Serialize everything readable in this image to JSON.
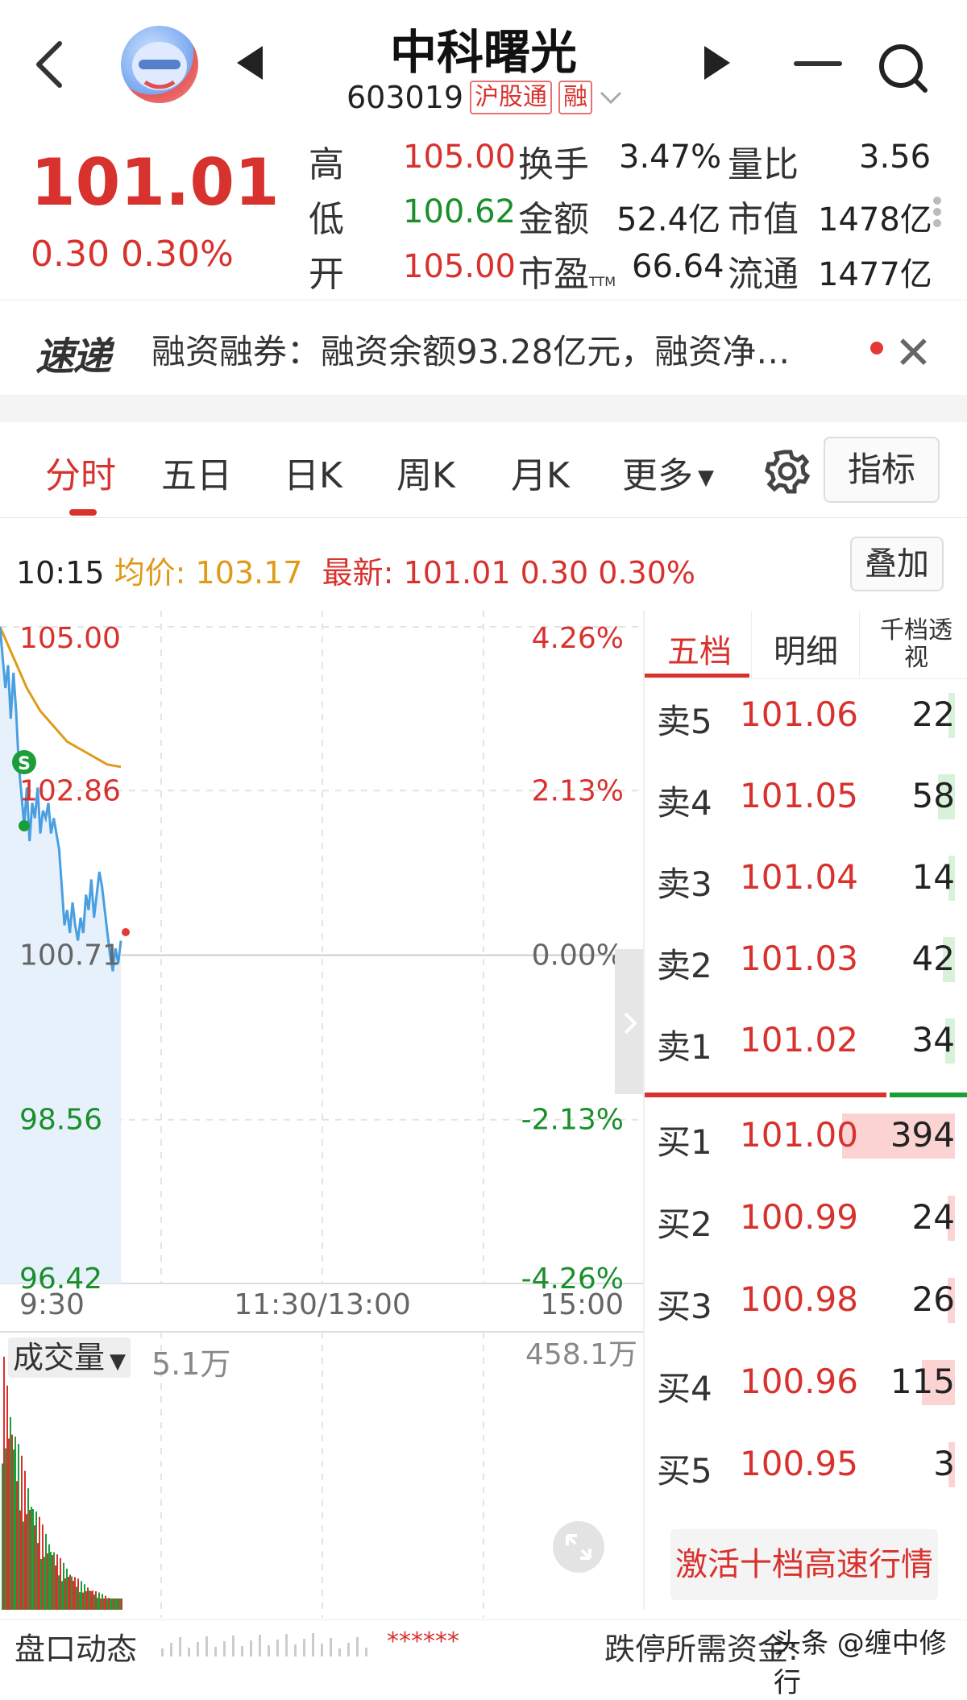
{
  "header": {
    "title": "中科曙光",
    "code": "603019",
    "tags": [
      "沪股通",
      "融"
    ]
  },
  "quote": {
    "price": "101.01",
    "change": "0.30",
    "change_pct": "0.30%",
    "stats": [
      {
        "label": "高",
        "value": "105.00",
        "color": "red"
      },
      {
        "label": "低",
        "value": "100.62",
        "color": "green"
      },
      {
        "label": "开",
        "value": "105.00",
        "color": "red"
      },
      {
        "label": "换手",
        "value": "3.47%"
      },
      {
        "label": "金额",
        "value": "52.4亿"
      },
      {
        "label": "市盈",
        "sub": "TTM",
        "value": "66.64"
      },
      {
        "label": "量比",
        "value": "3.56"
      },
      {
        "label": "市值",
        "value": "1478亿"
      },
      {
        "label": "流通",
        "value": "1477亿"
      }
    ]
  },
  "news": {
    "logo": "速递",
    "text": "融资融券：融资余额93.28亿元，融资净…"
  },
  "tabs": [
    "分时",
    "五日",
    "日K",
    "周K",
    "月K",
    "更多"
  ],
  "buttons": {
    "indicator": "指标",
    "overlay": "叠加",
    "activate": "激活十档高速行情"
  },
  "info_bar": {
    "time": "10:15",
    "avg_label": "均价:",
    "avg_value": "103.17",
    "latest_label": "最新:",
    "latest_value": "101.01 0.30 0.30%"
  },
  "chart_data": {
    "type": "line",
    "title": "",
    "y_left_ticks": [
      "105.00",
      "102.86",
      "100.71",
      "98.56",
      "96.42"
    ],
    "y_right_ticks": [
      "4.26%",
      "2.13%",
      "0.00%",
      "-2.13%",
      "-4.26%"
    ],
    "x_ticks": [
      "9:30",
      "11:30/13:00",
      "15:00"
    ],
    "ylim": [
      96.42,
      105.0
    ],
    "prev_close": 100.71,
    "session_minutes": 240,
    "series": [
      {
        "color": "#4a9fe0",
        "x": [
          0,
          1,
          2,
          3,
          4,
          5,
          6,
          7,
          8,
          9,
          10,
          11,
          12,
          13,
          14,
          15,
          16,
          17,
          18,
          19,
          20,
          21,
          22,
          23,
          24,
          25,
          26,
          27,
          28,
          29,
          30,
          31,
          32,
          33,
          34,
          35,
          36,
          37,
          38,
          39,
          40,
          41,
          42,
          43,
          44,
          45
        ],
        "values": [
          105.0,
          104.6,
          104.2,
          104.5,
          103.8,
          104.4,
          103.9,
          103.2,
          102.8,
          102.4,
          102.9,
          102.2,
          102.7,
          102.5,
          102.9,
          102.3,
          102.6,
          102.5,
          102.7,
          102.3,
          102.5,
          102.3,
          102.1,
          101.6,
          101.1,
          101.3,
          101.0,
          101.4,
          101.1,
          100.9,
          101.2,
          101.0,
          101.5,
          101.3,
          101.7,
          101.2,
          101.5,
          101.8,
          101.6,
          101.3,
          101.0,
          100.7,
          100.5,
          100.8,
          100.6,
          100.9
        ]
      },
      {
        "color": "#e09a1a",
        "x": [
          0,
          5,
          10,
          15,
          20,
          25,
          30,
          35,
          40,
          45
        ],
        "values": [
          105.0,
          104.6,
          104.2,
          103.9,
          103.7,
          103.5,
          103.4,
          103.3,
          103.2,
          103.17
        ]
      }
    ],
    "volume_max": "458.1万",
    "volume_latest": "5.1万"
  },
  "order_book": {
    "tabs": [
      "五档",
      "明细",
      "千档透视"
    ],
    "asks": [
      {
        "label": "卖5",
        "price": "101.06",
        "vol": "22"
      },
      {
        "label": "卖4",
        "price": "101.05",
        "vol": "58"
      },
      {
        "label": "卖3",
        "price": "101.04",
        "vol": "14"
      },
      {
        "label": "卖2",
        "price": "101.03",
        "vol": "42"
      },
      {
        "label": "卖1",
        "price": "101.02",
        "vol": "34"
      }
    ],
    "bids": [
      {
        "label": "买1",
        "price": "101.00",
        "vol": "394"
      },
      {
        "label": "买2",
        "price": "100.99",
        "vol": "24"
      },
      {
        "label": "买3",
        "price": "100.98",
        "vol": "26"
      },
      {
        "label": "买4",
        "price": "100.96",
        "vol": "115"
      },
      {
        "label": "买5",
        "price": "100.95",
        "vol": "3"
      }
    ]
  },
  "volume": {
    "selector": "成交量"
  },
  "footer": {
    "left": "盘口动态",
    "stars": "******",
    "right": "跌停所需资金:",
    "watermark": "头条 @缠中修行"
  }
}
